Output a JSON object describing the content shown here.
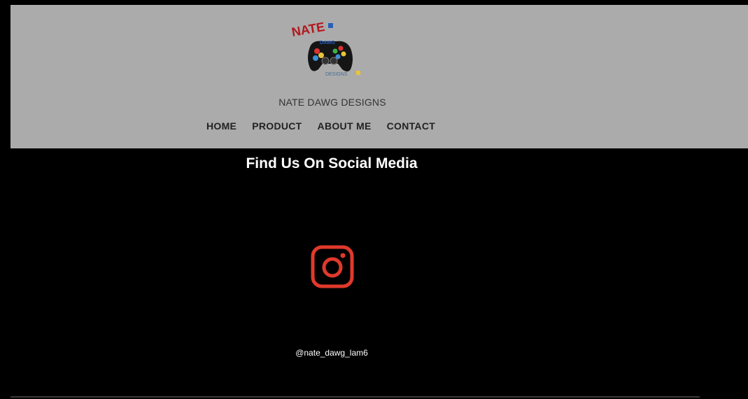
{
  "header": {
    "logo": {
      "text_top": "NATE",
      "text_mid": "DAWG",
      "text_bottom": "DESIGNS"
    },
    "site_name": "NATE DAWG DESIGNS",
    "nav": [
      {
        "label": "HOME"
      },
      {
        "label": "PRODUCT"
      },
      {
        "label": "ABOUT ME"
      },
      {
        "label": "CONTACT"
      }
    ],
    "background_color": "#ababab"
  },
  "main": {
    "social_title": "Find Us On Social Media",
    "instagram": {
      "icon": "instagram-icon",
      "handle": "@nate_dawg_lam6",
      "color": "#e0392b"
    }
  }
}
